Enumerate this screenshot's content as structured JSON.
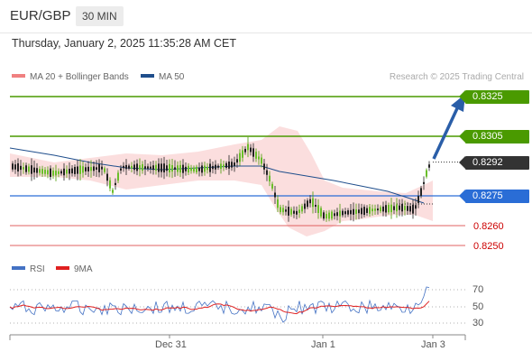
{
  "header": {
    "symbol": "EUR/GBP",
    "timeframe": "30 MIN"
  },
  "datetime": "Thursday, January 2, 2025 11:35:28 AM CET",
  "legend": {
    "bb_label": "MA 20 + Bollinger Bands",
    "ma50_label": "MA 50",
    "bb_color": "#f08080",
    "ma50_color": "#1f4e8c"
  },
  "credit": "Research © 2025 Trading Central",
  "levels": {
    "r2": "0.8325",
    "r1": "0.8305",
    "last": "0.8292",
    "pivot": "0.8275",
    "s1": "0.8260",
    "s2": "0.8250"
  },
  "colors": {
    "resistance": "#4a9a00",
    "pivot": "#2a6dd6",
    "support": "#e06060",
    "target_arrow": "#2a5ea8",
    "last": "#333333"
  },
  "rsi": {
    "legend_rsi": "RSI",
    "legend_ma": "9MA",
    "ticks": [
      "70",
      "50",
      "30"
    ],
    "rsi_color": "#4472c4",
    "ma_color": "#e02020"
  },
  "x_axis": {
    "ticks": [
      "Dec 31",
      "Jan 1",
      "Jan 3"
    ]
  }
}
